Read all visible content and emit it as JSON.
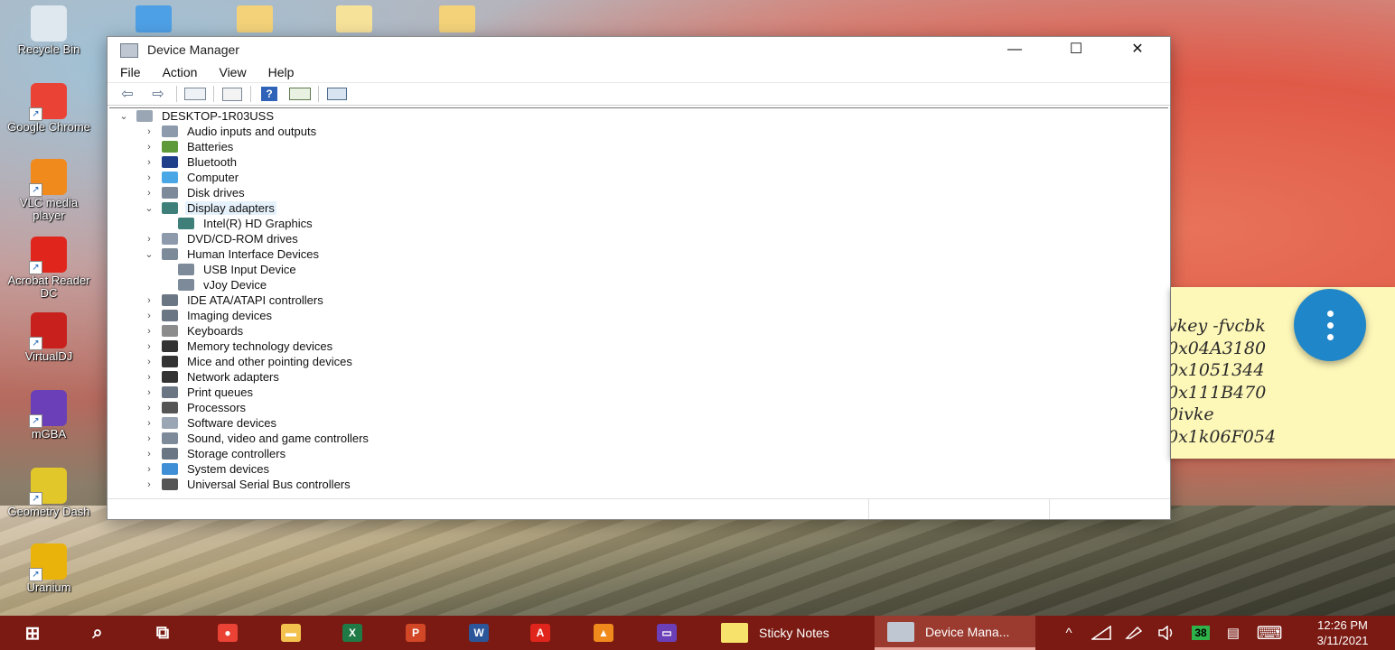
{
  "desktop": {
    "icons": [
      {
        "label": "Recycle Bin",
        "icon": "recycle-bin-icon",
        "color": "#dfe8ef"
      },
      {
        "label": "Google Chrome",
        "icon": "chrome-icon",
        "color": "#ea4335"
      },
      {
        "label": "VLC media player",
        "icon": "vlc-icon",
        "color": "#f08a1c"
      },
      {
        "label": "Acrobat Reader DC",
        "icon": "acrobat-icon",
        "color": "#e0261c"
      },
      {
        "label": "VirtualDJ",
        "icon": "virtualdj-icon",
        "color": "#c8201d"
      },
      {
        "label": "mGBA",
        "icon": "mgba-icon",
        "color": "#6b3fb7"
      },
      {
        "label": "Geometry Dash",
        "icon": "geometry-dash-icon",
        "color": "#e2c72a"
      },
      {
        "label": "Uranium",
        "icon": "uranium-icon",
        "color": "#e9b30c"
      }
    ]
  },
  "window": {
    "title": "Device Manager",
    "controls": {
      "minimize": "—",
      "maximize": "☐",
      "close": "✕"
    },
    "menu": [
      "File",
      "Action",
      "View",
      "Help"
    ],
    "toolbar": {
      "back": "⇦",
      "forward": "⇨",
      "help": "?"
    },
    "tree": {
      "root": "DESKTOP-1R03USS",
      "items": [
        {
          "label": "Audio inputs and outputs",
          "expanded": false,
          "level": 1
        },
        {
          "label": "Batteries",
          "expanded": false,
          "level": 1
        },
        {
          "label": "Bluetooth",
          "expanded": false,
          "level": 1
        },
        {
          "label": "Computer",
          "expanded": false,
          "level": 1
        },
        {
          "label": "Disk drives",
          "expanded": false,
          "level": 1
        },
        {
          "label": "Display adapters",
          "expanded": true,
          "level": 1,
          "selected": true
        },
        {
          "label": "Intel(R) HD Graphics",
          "level": 2
        },
        {
          "label": "DVD/CD-ROM drives",
          "expanded": false,
          "level": 1
        },
        {
          "label": "Human Interface Devices",
          "expanded": true,
          "level": 1
        },
        {
          "label": "USB Input Device",
          "level": 2
        },
        {
          "label": "vJoy Device",
          "level": 2
        },
        {
          "label": "IDE ATA/ATAPI controllers",
          "expanded": false,
          "level": 1
        },
        {
          "label": "Imaging devices",
          "expanded": false,
          "level": 1
        },
        {
          "label": "Keyboards",
          "expanded": false,
          "level": 1
        },
        {
          "label": "Memory technology devices",
          "expanded": false,
          "level": 1
        },
        {
          "label": "Mice and other pointing devices",
          "expanded": false,
          "level": 1
        },
        {
          "label": "Network adapters",
          "expanded": false,
          "level": 1
        },
        {
          "label": "Print queues",
          "expanded": false,
          "level": 1
        },
        {
          "label": "Processors",
          "expanded": false,
          "level": 1
        },
        {
          "label": "Software devices",
          "expanded": false,
          "level": 1
        },
        {
          "label": "Sound, video and game controllers",
          "expanded": false,
          "level": 1
        },
        {
          "label": "Storage controllers",
          "expanded": false,
          "level": 1
        },
        {
          "label": "System devices",
          "expanded": false,
          "level": 1
        },
        {
          "label": "Universal Serial Bus controllers",
          "expanded": false,
          "level": 1
        }
      ]
    }
  },
  "sticky_note": {
    "lines": [
      "vkey -fvcbk",
      "0x04A3180",
      "0x1051344",
      "0x111B470",
      "0ivke",
      "0x1k06F054"
    ],
    "background": "#fdf7b8",
    "fab_color": "#1f86c9"
  },
  "taskbar": {
    "pinned": [
      {
        "icon": "windows-start-icon",
        "glyph": "⊞",
        "color": "#ffffff"
      },
      {
        "icon": "search-icon",
        "glyph": "⌕",
        "color": "#ffffff"
      },
      {
        "icon": "task-view-icon",
        "glyph": "⧉",
        "color": "#ffffff"
      },
      {
        "icon": "chrome-icon",
        "glyph": "●",
        "color": "#ea4335"
      },
      {
        "icon": "file-explorer-icon",
        "glyph": "▬",
        "color": "#f2c14e"
      },
      {
        "icon": "excel-icon",
        "glyph": "X",
        "color": "#1f7a45"
      },
      {
        "icon": "powerpoint-icon",
        "glyph": "P",
        "color": "#d24726"
      },
      {
        "icon": "word-icon",
        "glyph": "W",
        "color": "#2b579a"
      },
      {
        "icon": "acrobat-icon",
        "glyph": "A",
        "color": "#e0261c"
      },
      {
        "icon": "vlc-icon",
        "glyph": "▲",
        "color": "#f08a1c"
      },
      {
        "icon": "mgba-icon",
        "glyph": "▭",
        "color": "#6b3fb7"
      }
    ],
    "windows": [
      {
        "label": "Sticky Notes",
        "icon": "sticky-notes-icon",
        "color": "#f7e36b",
        "active": false
      },
      {
        "label": "Device Mana...",
        "icon": "device-manager-icon",
        "color": "#bfc7d2",
        "active": true
      }
    ],
    "tray": {
      "chevron": "^",
      "battery_percent": "38",
      "keyboard": "⌨",
      "notifications": "▤"
    },
    "clock": {
      "time": "12:26 PM",
      "date": "3/11/2021"
    },
    "background": "#7a1a12"
  }
}
